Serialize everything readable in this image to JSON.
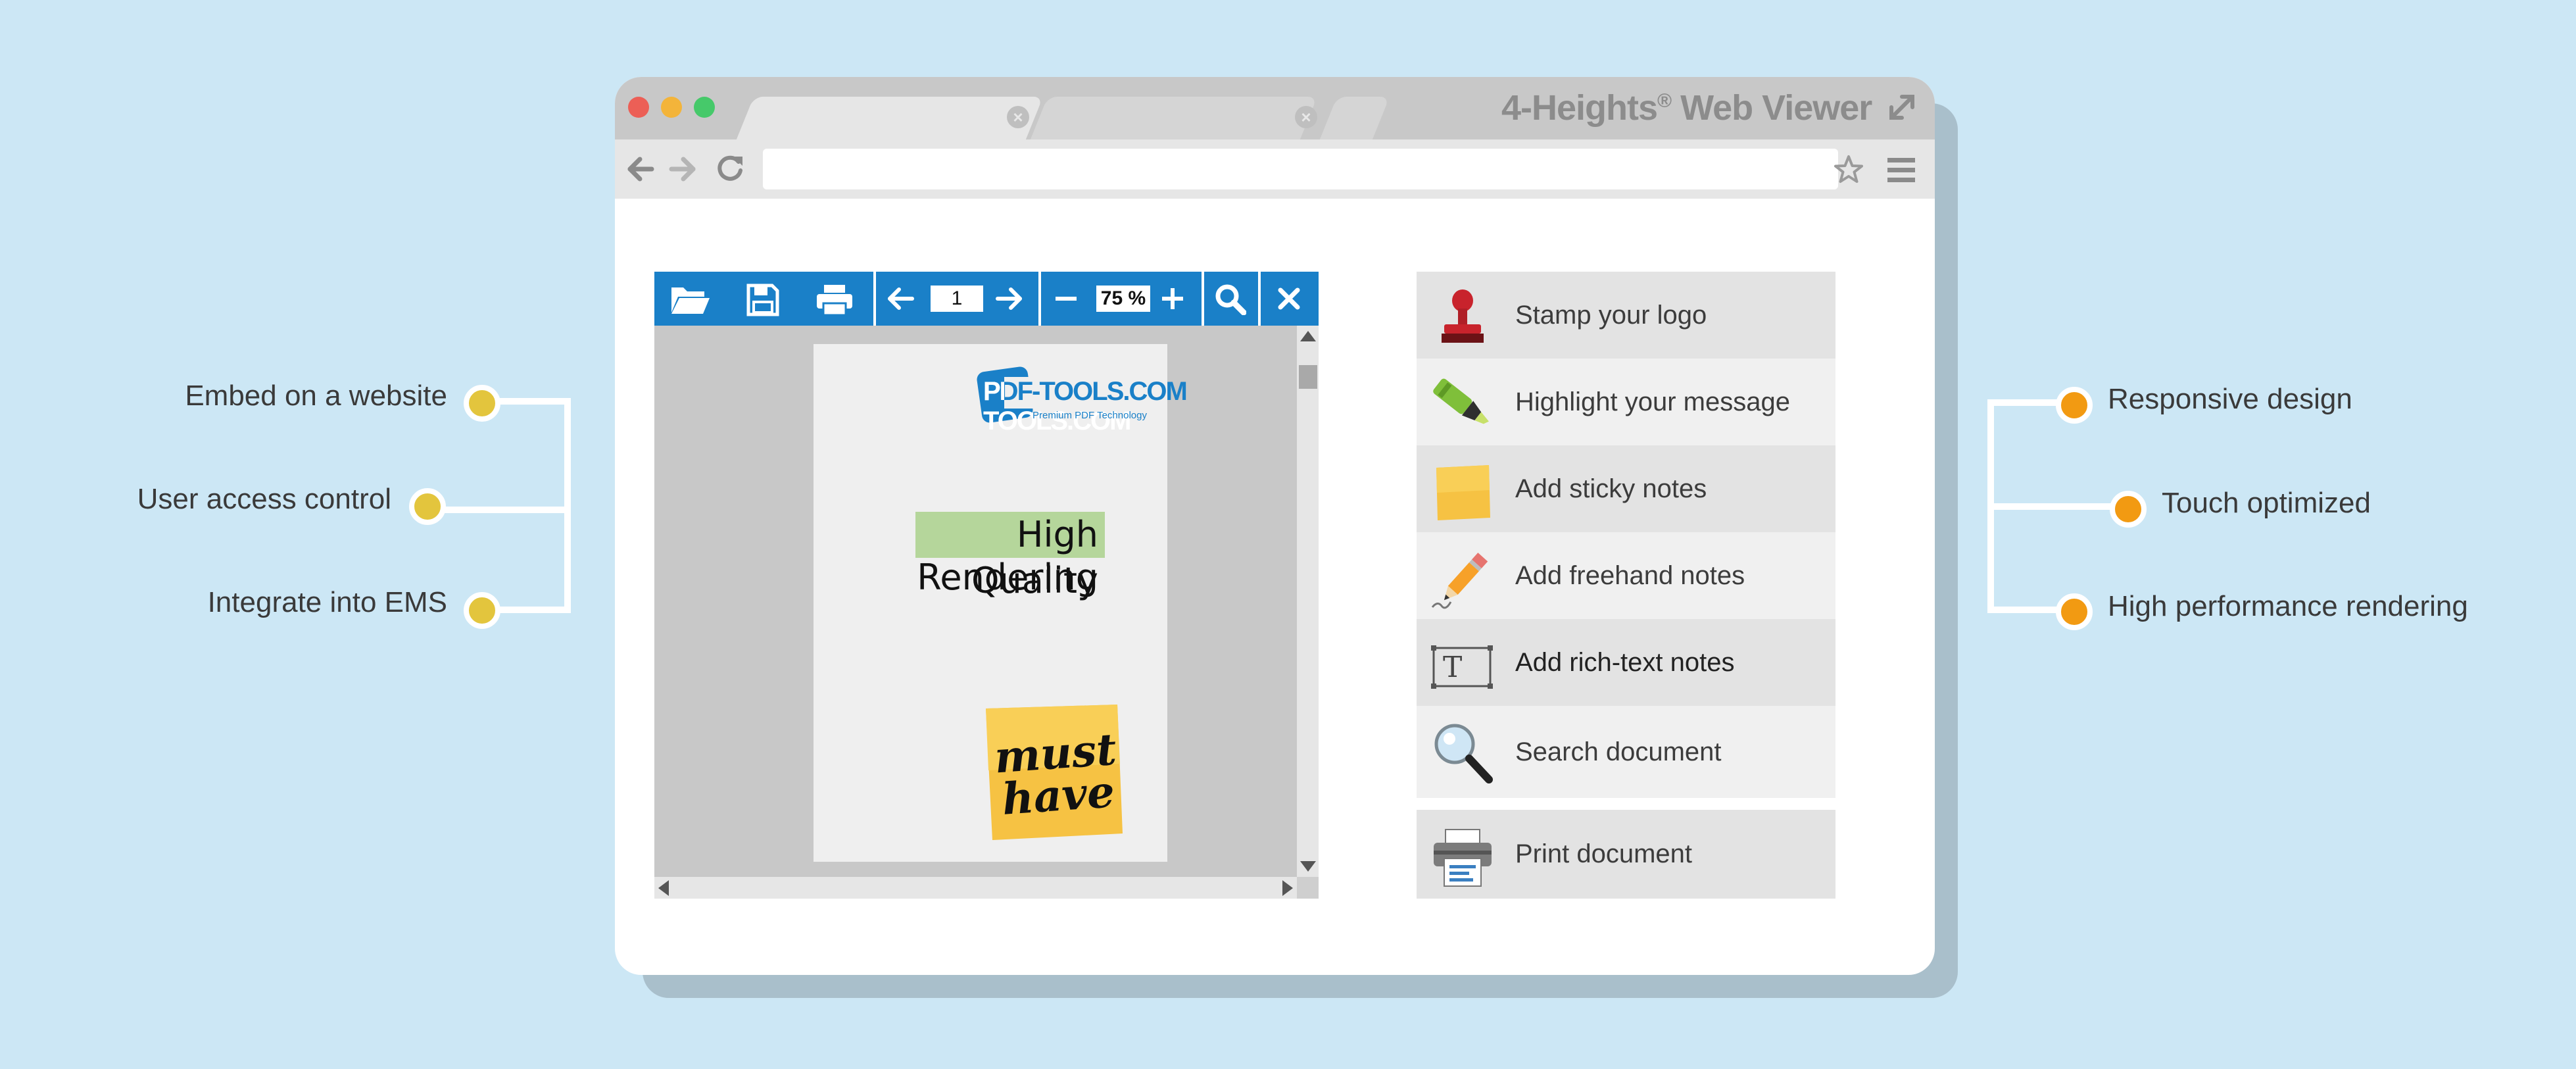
{
  "window": {
    "title": "4-Heights",
    "title_sup": "®",
    "title_suffix": " Web Viewer",
    "url": ""
  },
  "colors": {
    "background": "#cce7f5",
    "toolbar": "#1a80c8",
    "bullet_left": "#e3c53d",
    "bullet_right": "#f29a12",
    "traffic_red": "#ec5f56",
    "traffic_yellow": "#f3b43a",
    "traffic_green": "#46c96a"
  },
  "toolbar": {
    "page_number": "1",
    "zoom": "75 %"
  },
  "document": {
    "logo_text": "PDF-TOOLS.COM",
    "logo_tagline": "Premium PDF Technology",
    "headline_highlighted": "High Quality",
    "headline_second": "Rendering",
    "sticky_line1": "must",
    "sticky_line2": "have"
  },
  "features": [
    {
      "label": "Stamp your logo",
      "icon": "stamp-icon"
    },
    {
      "label": "Highlight your message",
      "icon": "highlighter-icon"
    },
    {
      "label": "Add sticky notes",
      "icon": "sticky-note-icon"
    },
    {
      "label": "Add freehand notes",
      "icon": "pencil-icon"
    },
    {
      "label": "Add rich-text notes",
      "icon": "text-box-icon"
    },
    {
      "label": "Search document",
      "icon": "magnifier-icon"
    },
    {
      "label": "Print document",
      "icon": "printer-icon"
    }
  ],
  "left_features": [
    "Embed on a website",
    "User access control",
    "Integrate into EMS"
  ],
  "right_features": [
    "Responsive design",
    "Touch optimized",
    "High performance rendering"
  ]
}
